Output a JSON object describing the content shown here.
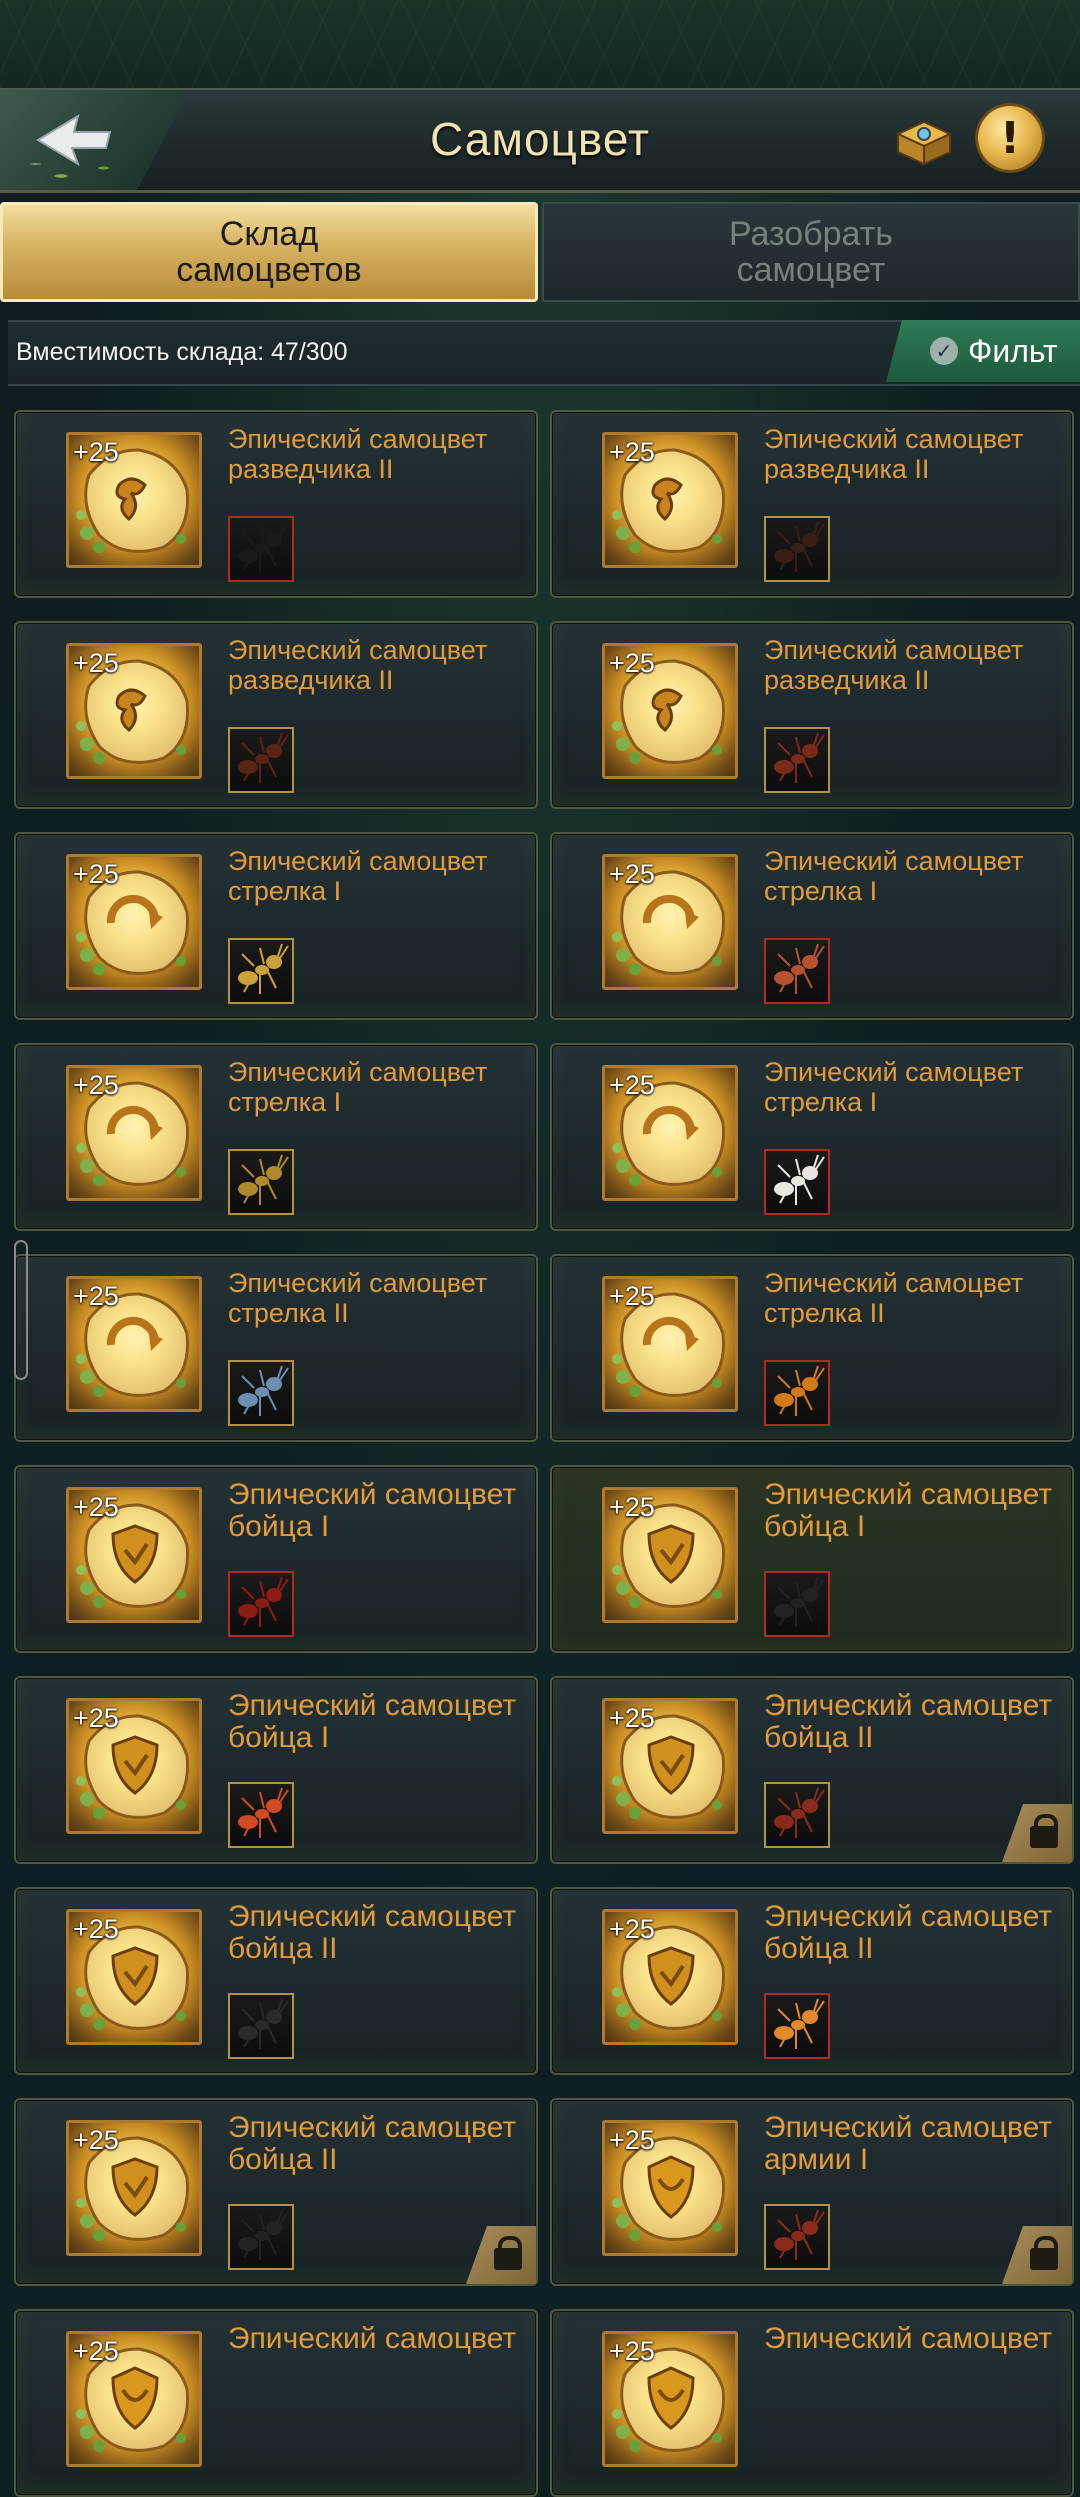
{
  "header": {
    "title": "Самоцвет"
  },
  "tabs": [
    {
      "label": "Склад\nсамоцветов",
      "active": true
    },
    {
      "label": "Разобрать\nсамоцвет",
      "active": false
    }
  ],
  "storage": {
    "capacity_text": "Вместимость склада: 47/300",
    "filter_label": "Фильт"
  },
  "items": [
    {
      "title": "Эпический самоцвет разведчика II",
      "bonus": "+25",
      "ant": "black-ant",
      "ant_border": "red",
      "emblem": "scout",
      "locked": false
    },
    {
      "title": "Эпический самоцвет разведчика II",
      "bonus": "+25",
      "ant": "dark-ant",
      "ant_border": "gold",
      "emblem": "scout",
      "locked": false
    },
    {
      "title": "Эпический самоцвет разведчика II",
      "bonus": "+25",
      "ant": "brown-ant",
      "ant_border": "gold",
      "emblem": "scout",
      "locked": false
    },
    {
      "title": "Эпический самоцвет разведчика II",
      "bonus": "+25",
      "ant": "red-brown-ant",
      "ant_border": "gold",
      "emblem": "scout",
      "locked": false
    },
    {
      "title": "Эпический самоцвет стрелка I",
      "bonus": "+25",
      "ant": "yellow-striped-ant",
      "ant_border": "gold",
      "emblem": "shooter",
      "locked": false
    },
    {
      "title": "Эпический самоцвет стрелка I",
      "bonus": "+25",
      "ant": "red-ant",
      "ant_border": "red",
      "emblem": "shooter",
      "locked": false
    },
    {
      "title": "Эпический самоцвет стрелка I",
      "bonus": "+25",
      "ant": "black-gold-ant",
      "ant_border": "gold",
      "emblem": "shooter",
      "locked": false
    },
    {
      "title": "Эпический самоцвет стрелка I",
      "bonus": "+25",
      "ant": "white-fuzzy-ant",
      "ant_border": "red",
      "emblem": "shooter",
      "locked": false
    },
    {
      "title": "Эпический самоцвет стрелка II",
      "bonus": "+25",
      "ant": "blue-ant",
      "ant_border": "gold",
      "emblem": "shooter",
      "locked": false
    },
    {
      "title": "Эпический самоцвет стрелка II",
      "bonus": "+25",
      "ant": "orange-ant",
      "ant_border": "red",
      "emblem": "shooter",
      "locked": false
    },
    {
      "title": "Эпический самоцвет бойца I",
      "bonus": "+25",
      "ant": "red-spiky-ant",
      "ant_border": "red",
      "emblem": "fighter",
      "locked": false
    },
    {
      "title": "Эпический самоцвет бойца I",
      "bonus": "+25",
      "ant": "black-beetle",
      "ant_border": "red",
      "emblem": "fighter",
      "locked": false,
      "highlight": true
    },
    {
      "title": "Эпический самоцвет бойца I",
      "bonus": "+25",
      "ant": "orange-red-ant",
      "ant_border": "gold",
      "emblem": "fighter",
      "locked": false
    },
    {
      "title": "Эпический самоцвет бойца II",
      "bonus": "+25",
      "ant": "red-black-ant",
      "ant_border": "gold",
      "emblem": "fighter",
      "locked": true
    },
    {
      "title": "Эпический самоцвет бойца II",
      "bonus": "+25",
      "ant": "black-long-ant",
      "ant_border": "gold",
      "emblem": "fighter",
      "locked": false
    },
    {
      "title": "Эпический самоцвет бойца II",
      "bonus": "+25",
      "ant": "orange-big-ant",
      "ant_border": "red",
      "emblem": "fighter",
      "locked": false
    },
    {
      "title": "Эпический самоцвет бойца II",
      "bonus": "+25",
      "ant": "black-beetle",
      "ant_border": "gold",
      "emblem": "fighter",
      "locked": true
    },
    {
      "title": "Эпический самоцвет армии I",
      "bonus": "+25",
      "ant": "red-black-ant",
      "ant_border": "gold",
      "emblem": "army",
      "locked": true
    },
    {
      "title": "Эпический самоцвет",
      "bonus": "+25",
      "ant": "",
      "ant_border": "gold",
      "emblem": "army",
      "locked": false
    },
    {
      "title": "Эпический самоцвет",
      "bonus": "+25",
      "ant": "",
      "ant_border": "gold",
      "emblem": "army",
      "locked": false
    }
  ],
  "ant_colors": {
    "black-ant": "#1a1a1a",
    "dark-ant": "#3a1e16",
    "brown-ant": "#5a2414",
    "red-brown-ant": "#7a2a1a",
    "yellow-striped-ant": "#c9a23a",
    "red-ant": "#b5532e",
    "black-gold-ant": "#b08a2a",
    "white-fuzzy-ant": "#e8e8e0",
    "blue-ant": "#6c8fb0",
    "orange-ant": "#d27a16",
    "red-spiky-ant": "#8a1c14",
    "black-beetle": "#222222",
    "orange-red-ant": "#d04a22",
    "red-black-ant": "#8a2a1a",
    "black-long-ant": "#2a2a2a",
    "orange-big-ant": "#e08a2a"
  }
}
